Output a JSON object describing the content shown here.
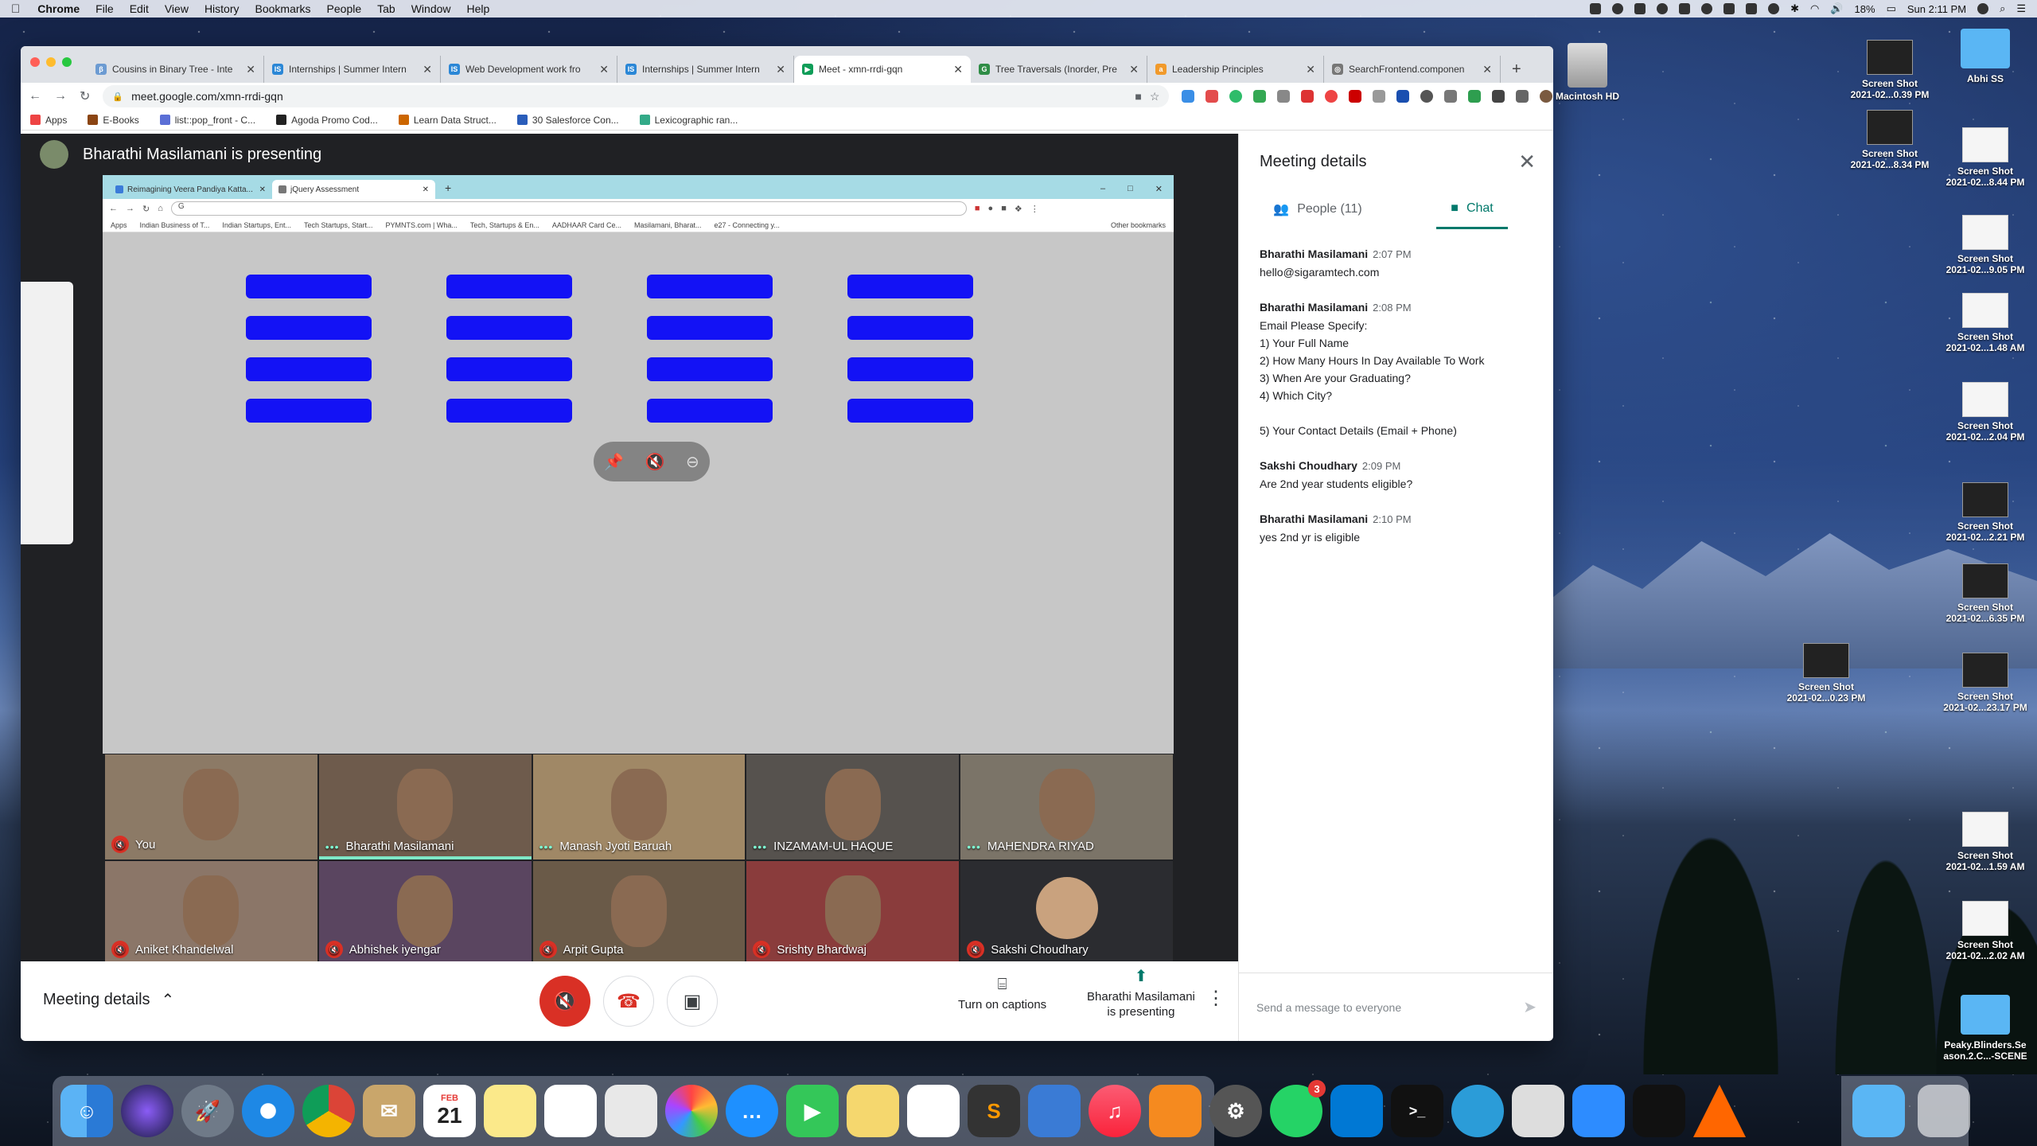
{
  "menubar": {
    "app": "Chrome",
    "items": [
      "File",
      "Edit",
      "View",
      "History",
      "Bookmarks",
      "People",
      "Tab",
      "Window",
      "Help"
    ],
    "battery": "18%",
    "clock": "Sun 2:11 PM"
  },
  "tabs": [
    {
      "title": "Cousins in Binary Tree - Inte",
      "color": "#6c9bd2",
      "glyph": "β"
    },
    {
      "title": "Internships | Summer Intern",
      "color": "#2b87d6",
      "glyph": "IS"
    },
    {
      "title": "Web Development work fro",
      "color": "#2b87d6",
      "glyph": "IS"
    },
    {
      "title": "Internships | Summer Intern",
      "color": "#2b87d6",
      "glyph": "IS"
    },
    {
      "title": "Meet - xmn-rrdi-gqn",
      "color": "#0f9d58",
      "glyph": "▶",
      "active": true
    },
    {
      "title": "Tree Traversals (Inorder, Pre",
      "color": "#2f8d46",
      "glyph": "G"
    },
    {
      "title": "Leadership Principles",
      "color": "#f19a2b",
      "glyph": "a"
    },
    {
      "title": "SearchFrontend.componen",
      "color": "#777",
      "glyph": "◎"
    }
  ],
  "address": {
    "url": "meet.google.com/xmn-rrdi-gqn"
  },
  "bookmarks": [
    "Apps",
    "E-Books",
    "list::pop_front - C...",
    "Agoda Promo Cod...",
    "Learn Data Struct...",
    "30 Salesforce Con...",
    "Lexicographic ran..."
  ],
  "meet": {
    "presenting_header": "Bharathi Masilamani is presenting",
    "shared_screen": {
      "tabs": [
        "Reimagining Veera Pandiya Katta...",
        "jQuery Assessment"
      ],
      "bookmarks": [
        "Apps",
        "Indian Business of T...",
        "Indian Startups, Ent...",
        "Tech Startups, Start...",
        "PYMNTS.com | Wha...",
        "Tech, Startups & En...",
        "AADHAAR Card Ce...",
        "Masilamani, Bharat...",
        "e27 - Connecting y..."
      ],
      "other_bookmarks": "Other bookmarks"
    },
    "participants": [
      {
        "name": "You",
        "muted": true,
        "bg": "#8c7a66"
      },
      {
        "name": "Bharathi Masilamani",
        "muted": false,
        "active": true,
        "bg": "#6e5b4c"
      },
      {
        "name": "Manash Jyoti Baruah",
        "muted": false,
        "bg": "#a08866"
      },
      {
        "name": "INZAMAM-UL HAQUE",
        "muted": false,
        "bg": "#56524e"
      },
      {
        "name": "MAHENDRA RIYAD",
        "muted": false,
        "bg": "#7b7468"
      },
      {
        "name": "Aniket Khandelwal",
        "muted": true,
        "bg": "#8b7668"
      },
      {
        "name": "Abhishek iyengar",
        "muted": true,
        "bg": "#5a4560"
      },
      {
        "name": "Arpit Gupta",
        "muted": true,
        "bg": "#6a5a48"
      },
      {
        "name": "Srishty Bhardwaj",
        "muted": true,
        "bg": "#8a3c3c"
      },
      {
        "name": "Sakshi Choudhary",
        "muted": true,
        "bg": "#2b2c30"
      }
    ],
    "bottom": {
      "meeting_details": "Meeting details",
      "captions": "Turn on captions",
      "presenting_line1": "Bharathi Masilamani",
      "presenting_line2": "is presenting"
    },
    "panel": {
      "title": "Meeting details",
      "people_tab": "People (11)",
      "chat_tab": "Chat",
      "messages": [
        {
          "sender": "Bharathi Masilamani",
          "time": "2:07 PM",
          "lines": [
            "hello@sigaramtech.com"
          ]
        },
        {
          "sender": "Bharathi Masilamani",
          "time": "2:08 PM",
          "lines": [
            "Email Please Specify:",
            "1) Your Full Name",
            "2) How Many Hours In Day Available To Work",
            "3) When Are your Graduating?",
            "4) Which City?",
            "",
            "5) Your Contact Details (Email + Phone)"
          ]
        },
        {
          "sender": "Sakshi Choudhary",
          "time": "2:09 PM",
          "lines": [
            "Are 2nd year students eligible?"
          ]
        },
        {
          "sender": "Bharathi Masilamani",
          "time": "2:10 PM",
          "lines": [
            "yes 2nd yr is eligible"
          ]
        }
      ],
      "compose_placeholder": "Send a message to everyone"
    }
  },
  "desktop": {
    "macintosh": "Macintosh HD",
    "items": [
      {
        "label1": "Screen Shot",
        "label2": "2021-02...0.39 PM",
        "type": "dark"
      },
      {
        "label1": "Abhi SS",
        "label2": "",
        "type": "folder"
      },
      {
        "label1": "Screen Shot",
        "label2": "2021-02...8.34 PM",
        "type": "dark"
      },
      {
        "label1": "Screen Shot",
        "label2": "2021-02...8.44 PM",
        "type": "light"
      },
      {
        "label1": "Screen Shot",
        "label2": "2021-02...9.05 PM",
        "type": "light"
      },
      {
        "label1": "Screen Shot",
        "label2": "2021-02...1.48 AM",
        "type": "light"
      },
      {
        "label1": "Screen Shot",
        "label2": "2021-02...2.04 PM",
        "type": "light"
      },
      {
        "label1": "Screen Shot",
        "label2": "2021-02...2.21 PM",
        "type": "dark"
      },
      {
        "label1": "Screen Shot",
        "label2": "2021-02...6.35 PM",
        "type": "dark"
      },
      {
        "label1": "Screen Shot",
        "label2": "2021-02...0.23 PM",
        "type": "dark"
      },
      {
        "label1": "Screen Shot",
        "label2": "2021-02...23.17 PM",
        "type": "dark"
      },
      {
        "label1": "Screen Shot",
        "label2": "2021-02...1.59 AM",
        "type": "light"
      },
      {
        "label1": "Screen Shot",
        "label2": "2021-02...2.02 AM",
        "type": "light"
      },
      {
        "label1": "Peaky.Blinders.Se",
        "label2": "ason.2.C...-SCENE",
        "type": "folder"
      }
    ]
  },
  "dock": {
    "calendar_month": "FEB",
    "calendar_day": "21",
    "whatsapp_badge": "3"
  }
}
